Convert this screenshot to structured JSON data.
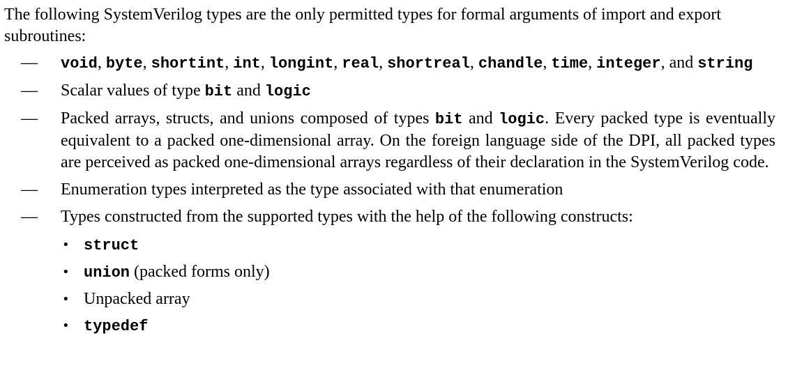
{
  "intro": "The following SystemVerilog types are the only permitted types for formal arguments of import and export subroutines:",
  "dash_glyph": "—",
  "bullet_glyph": "•",
  "items": [
    {
      "parts": [
        {
          "code": "void"
        },
        {
          "text": ", "
        },
        {
          "code": "byte"
        },
        {
          "text": ", "
        },
        {
          "code": "shortint"
        },
        {
          "text": ", "
        },
        {
          "code": "int"
        },
        {
          "text": ", "
        },
        {
          "code": "longint"
        },
        {
          "text": ", "
        },
        {
          "code": "real"
        },
        {
          "text": ", "
        },
        {
          "code": "shortreal"
        },
        {
          "text": ", "
        },
        {
          "code": "chandle"
        },
        {
          "text": ", "
        },
        {
          "code": "time"
        },
        {
          "text": ", "
        },
        {
          "code": "integer"
        },
        {
          "text": ", and "
        },
        {
          "code": "string"
        }
      ]
    },
    {
      "parts": [
        {
          "text": "Scalar values of type "
        },
        {
          "code": "bit"
        },
        {
          "text": " and "
        },
        {
          "code": "logic"
        }
      ]
    },
    {
      "parts": [
        {
          "text": "Packed arrays, structs, and unions composed of types "
        },
        {
          "code": "bit"
        },
        {
          "text": " and "
        },
        {
          "code": "logic"
        },
        {
          "text": ". Every packed type is eventually equivalent to a packed one-dimensional array. On the foreign language side of the DPI, all packed types are perceived as packed one-dimensional arrays regardless of their declaration in the SystemVerilog code."
        }
      ]
    },
    {
      "parts": [
        {
          "text": "Enumeration types interpreted as the type associated with that enumeration"
        }
      ]
    },
    {
      "parts": [
        {
          "text": "Types constructed from the supported types with the help of the following constructs:"
        }
      ],
      "subitems": [
        {
          "parts": [
            {
              "code": "struct"
            }
          ]
        },
        {
          "parts": [
            {
              "code": "union"
            },
            {
              "text": " (packed forms only)"
            }
          ]
        },
        {
          "parts": [
            {
              "text": "Unpacked array"
            }
          ]
        },
        {
          "parts": [
            {
              "code": "typedef"
            }
          ]
        }
      ]
    }
  ]
}
